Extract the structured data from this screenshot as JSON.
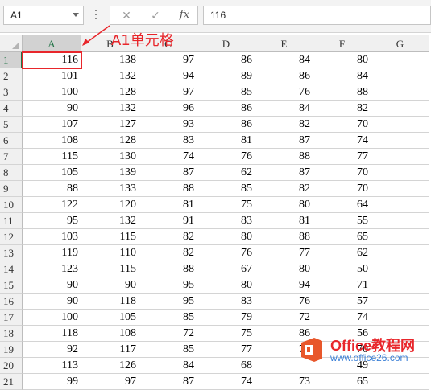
{
  "toolbar": {
    "name_box": "A1",
    "cancel_icon": "cancel-icon",
    "enter_icon": "enter-icon",
    "fx_label": "fx",
    "formula_value": "116"
  },
  "callout": {
    "text": "A1单元格",
    "color": "#e8262b"
  },
  "columns": [
    "A",
    "B",
    "C",
    "D",
    "E",
    "F",
    "G"
  ],
  "rows": [
    {
      "n": "1",
      "v": [
        "116",
        "138",
        "97",
        "86",
        "84",
        "80"
      ]
    },
    {
      "n": "2",
      "v": [
        "101",
        "132",
        "94",
        "89",
        "86",
        "84"
      ]
    },
    {
      "n": "3",
      "v": [
        "100",
        "128",
        "97",
        "85",
        "76",
        "88"
      ]
    },
    {
      "n": "4",
      "v": [
        "90",
        "132",
        "96",
        "86",
        "84",
        "82"
      ]
    },
    {
      "n": "5",
      "v": [
        "107",
        "127",
        "93",
        "86",
        "82",
        "70"
      ]
    },
    {
      "n": "6",
      "v": [
        "108",
        "128",
        "83",
        "81",
        "87",
        "74"
      ]
    },
    {
      "n": "7",
      "v": [
        "115",
        "130",
        "74",
        "76",
        "88",
        "77"
      ]
    },
    {
      "n": "8",
      "v": [
        "105",
        "139",
        "87",
        "62",
        "87",
        "70"
      ]
    },
    {
      "n": "9",
      "v": [
        "88",
        "133",
        "88",
        "85",
        "82",
        "70"
      ]
    },
    {
      "n": "10",
      "v": [
        "122",
        "120",
        "81",
        "75",
        "80",
        "64"
      ]
    },
    {
      "n": "11",
      "v": [
        "95",
        "132",
        "91",
        "83",
        "81",
        "55"
      ]
    },
    {
      "n": "12",
      "v": [
        "103",
        "115",
        "82",
        "80",
        "88",
        "65"
      ]
    },
    {
      "n": "13",
      "v": [
        "119",
        "110",
        "82",
        "76",
        "77",
        "62"
      ]
    },
    {
      "n": "14",
      "v": [
        "123",
        "115",
        "88",
        "67",
        "80",
        "50"
      ]
    },
    {
      "n": "15",
      "v": [
        "90",
        "90",
        "95",
        "80",
        "94",
        "71"
      ]
    },
    {
      "n": "16",
      "v": [
        "90",
        "118",
        "95",
        "83",
        "76",
        "57"
      ]
    },
    {
      "n": "17",
      "v": [
        "100",
        "105",
        "85",
        "79",
        "72",
        "74"
      ]
    },
    {
      "n": "18",
      "v": [
        "118",
        "108",
        "72",
        "75",
        "86",
        "56"
      ]
    },
    {
      "n": "19",
      "v": [
        "92",
        "117",
        "85",
        "77",
        "71",
        "70"
      ]
    },
    {
      "n": "20",
      "v": [
        "113",
        "126",
        "84",
        "68",
        "",
        "49"
      ]
    },
    {
      "n": "21",
      "v": [
        "99",
        "97",
        "87",
        "74",
        "73",
        "65"
      ]
    }
  ],
  "watermark": {
    "title_en": "Office",
    "title_cn": "教程网",
    "url": "www.office26.com"
  },
  "colors": {
    "accent": "#217346",
    "highlight": "#e8262b"
  }
}
